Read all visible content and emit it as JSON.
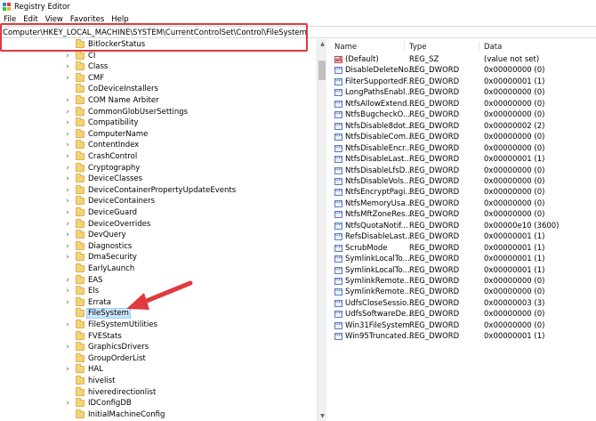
{
  "window": {
    "title": "Registry Editor"
  },
  "menu": [
    "File",
    "Edit",
    "View",
    "Favorites",
    "Help"
  ],
  "address": {
    "path": "Computer\\HKEY_LOCAL_MACHINE\\SYSTEM\\CurrentControlSet\\Control\\FileSystem"
  },
  "tree": {
    "items": [
      {
        "label": "BitlockerStatus",
        "expander": false
      },
      {
        "label": "CI",
        "expander": true
      },
      {
        "label": "Class",
        "expander": true
      },
      {
        "label": "CMF",
        "expander": true
      },
      {
        "label": "CoDeviceInstallers",
        "expander": false
      },
      {
        "label": "COM Name Arbiter",
        "expander": true
      },
      {
        "label": "CommonGlobUserSettings",
        "expander": true
      },
      {
        "label": "Compatibility",
        "expander": true
      },
      {
        "label": "ComputerName",
        "expander": true
      },
      {
        "label": "ContentIndex",
        "expander": true
      },
      {
        "label": "CrashControl",
        "expander": true
      },
      {
        "label": "Cryptography",
        "expander": true
      },
      {
        "label": "DeviceClasses",
        "expander": true
      },
      {
        "label": "DeviceContainerPropertyUpdateEvents",
        "expander": true
      },
      {
        "label": "DeviceContainers",
        "expander": true
      },
      {
        "label": "DeviceGuard",
        "expander": true
      },
      {
        "label": "DeviceOverrides",
        "expander": true
      },
      {
        "label": "DevQuery",
        "expander": true
      },
      {
        "label": "Diagnostics",
        "expander": true
      },
      {
        "label": "DmaSecurity",
        "expander": true
      },
      {
        "label": "EarlyLaunch",
        "expander": false
      },
      {
        "label": "EAS",
        "expander": true
      },
      {
        "label": "Els",
        "expander": true
      },
      {
        "label": "Errata",
        "expander": true
      },
      {
        "label": "FileSystem",
        "expander": false,
        "selected": true
      },
      {
        "label": "FileSystemUtilities",
        "expander": true
      },
      {
        "label": "FVEStats",
        "expander": false
      },
      {
        "label": "GraphicsDrivers",
        "expander": true
      },
      {
        "label": "GroupOrderList",
        "expander": false
      },
      {
        "label": "HAL",
        "expander": true
      },
      {
        "label": "hivelist",
        "expander": false
      },
      {
        "label": "hiveredirectionlist",
        "expander": false
      },
      {
        "label": "IDConfigDB",
        "expander": true
      },
      {
        "label": "InitialMachineConfig",
        "expander": false
      }
    ]
  },
  "values": {
    "headers": {
      "name": "Name",
      "type": "Type",
      "data": "Data"
    },
    "rows": [
      {
        "name": "(Default)",
        "type": "REG_SZ",
        "data": "(value not set)",
        "kind": "sz"
      },
      {
        "name": "DisableDeleteNo...",
        "type": "REG_DWORD",
        "data": "0x00000000 (0)",
        "kind": "dword"
      },
      {
        "name": "FilterSupportedF...",
        "type": "REG_DWORD",
        "data": "0x00000001 (1)",
        "kind": "dword"
      },
      {
        "name": "LongPathsEnabl...",
        "type": "REG_DWORD",
        "data": "0x00000000 (0)",
        "kind": "dword"
      },
      {
        "name": "NtfsAllowExtend...",
        "type": "REG_DWORD",
        "data": "0x00000000 (0)",
        "kind": "dword"
      },
      {
        "name": "NtfsBugcheckO...",
        "type": "REG_DWORD",
        "data": "0x00000000 (0)",
        "kind": "dword"
      },
      {
        "name": "NtfsDisable8dot...",
        "type": "REG_DWORD",
        "data": "0x00000002 (2)",
        "kind": "dword"
      },
      {
        "name": "NtfsDisableCom...",
        "type": "REG_DWORD",
        "data": "0x00000000 (0)",
        "kind": "dword"
      },
      {
        "name": "NtfsDisableEncr...",
        "type": "REG_DWORD",
        "data": "0x00000000 (0)",
        "kind": "dword"
      },
      {
        "name": "NtfsDisableLast...",
        "type": "REG_DWORD",
        "data": "0x00000001 (1)",
        "kind": "dword"
      },
      {
        "name": "NtfsDisableLfsD...",
        "type": "REG_DWORD",
        "data": "0x00000000 (0)",
        "kind": "dword"
      },
      {
        "name": "NtfsDisableVols...",
        "type": "REG_DWORD",
        "data": "0x00000000 (0)",
        "kind": "dword"
      },
      {
        "name": "NtfsEncryptPagi...",
        "type": "REG_DWORD",
        "data": "0x00000000 (0)",
        "kind": "dword"
      },
      {
        "name": "NtfsMemoryUsa...",
        "type": "REG_DWORD",
        "data": "0x00000000 (0)",
        "kind": "dword"
      },
      {
        "name": "NtfsMftZoneRes...",
        "type": "REG_DWORD",
        "data": "0x00000000 (0)",
        "kind": "dword"
      },
      {
        "name": "NtfsQuotaNotif...",
        "type": "REG_DWORD",
        "data": "0x00000e10 (3600)",
        "kind": "dword"
      },
      {
        "name": "RefsDisableLast...",
        "type": "REG_DWORD",
        "data": "0x00000001 (1)",
        "kind": "dword"
      },
      {
        "name": "ScrubMode",
        "type": "REG_DWORD",
        "data": "0x00000001 (1)",
        "kind": "dword"
      },
      {
        "name": "SymlinkLocalTo...",
        "type": "REG_DWORD",
        "data": "0x00000001 (1)",
        "kind": "dword"
      },
      {
        "name": "SymlinkLocalTo...",
        "type": "REG_DWORD",
        "data": "0x00000001 (1)",
        "kind": "dword"
      },
      {
        "name": "SymlinkRemote...",
        "type": "REG_DWORD",
        "data": "0x00000000 (0)",
        "kind": "dword"
      },
      {
        "name": "SymlinkRemote...",
        "type": "REG_DWORD",
        "data": "0x00000000 (0)",
        "kind": "dword"
      },
      {
        "name": "UdfsCloseSessio...",
        "type": "REG_DWORD",
        "data": "0x00000003 (3)",
        "kind": "dword"
      },
      {
        "name": "UdfsSoftwareDe...",
        "type": "REG_DWORD",
        "data": "0x00000000 (0)",
        "kind": "dword"
      },
      {
        "name": "Win31FileSystem",
        "type": "REG_DWORD",
        "data": "0x00000000 (0)",
        "kind": "dword"
      },
      {
        "name": "Win95Truncated...",
        "type": "REG_DWORD",
        "data": "0x00000001 (1)",
        "kind": "dword"
      }
    ]
  },
  "colors": {
    "annotation": "#e0393e",
    "selection": "#cce8ff",
    "folder": "#f3d27a"
  },
  "icons": {
    "expander": "chevron-right-icon",
    "folder": "folder-icon",
    "dword": "reg-dword-icon",
    "string": "reg-sz-icon"
  }
}
